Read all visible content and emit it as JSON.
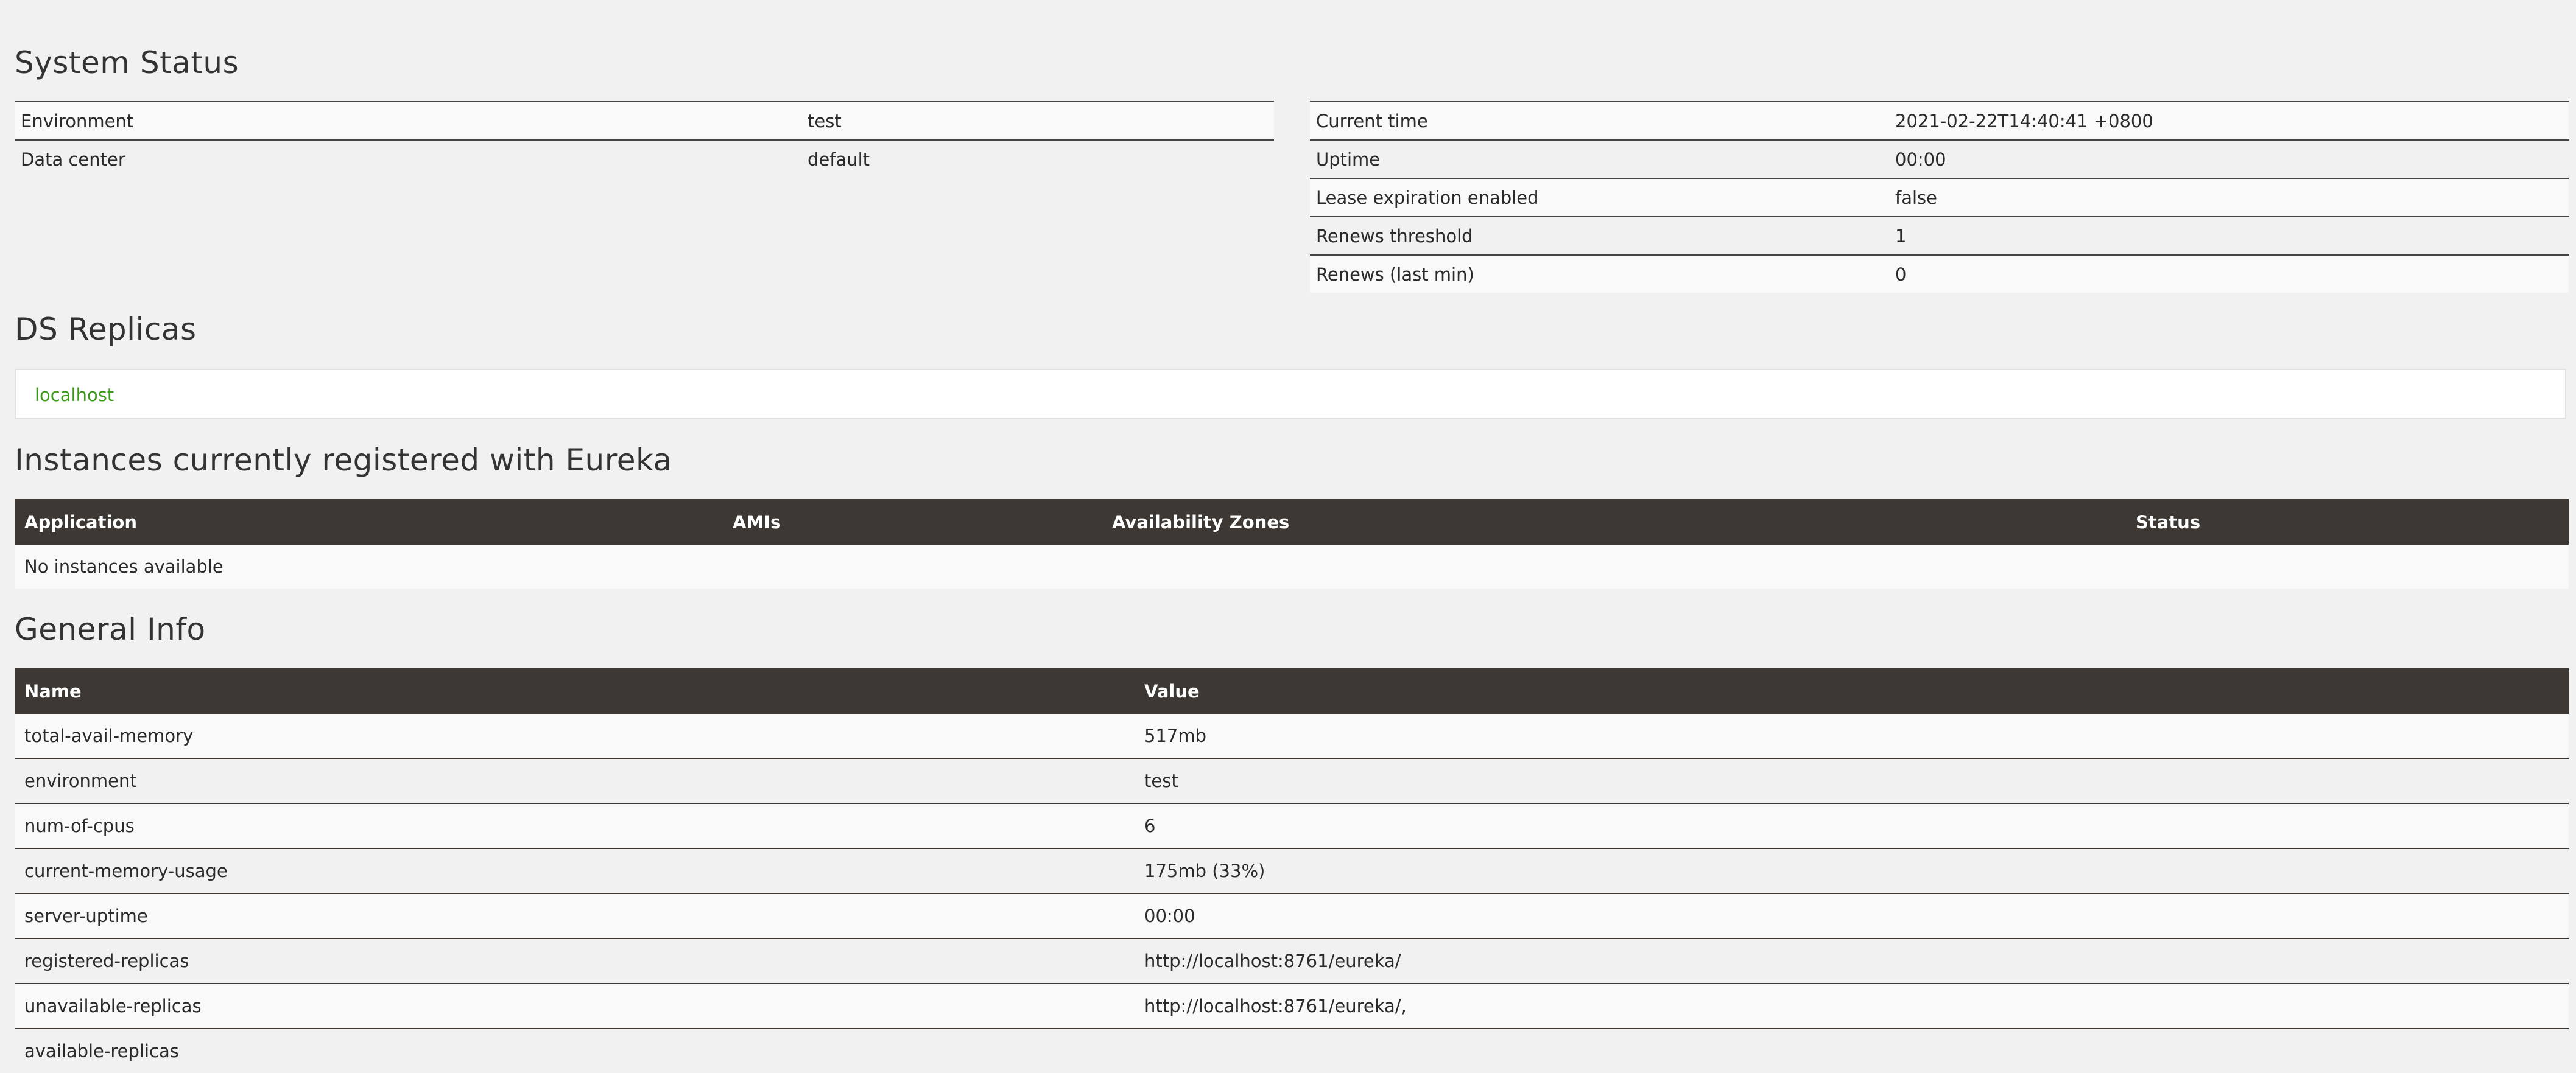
{
  "system_status": {
    "title": "System Status",
    "left_rows": [
      {
        "label": "Environment",
        "value": "test"
      },
      {
        "label": "Data center",
        "value": "default"
      }
    ],
    "right_rows": [
      {
        "label": "Current time",
        "value": "2021-02-22T14:40:41 +0800"
      },
      {
        "label": "Uptime",
        "value": "00:00"
      },
      {
        "label": "Lease expiration enabled",
        "value": "false"
      },
      {
        "label": "Renews threshold",
        "value": "1"
      },
      {
        "label": "Renews (last min)",
        "value": "0"
      }
    ]
  },
  "ds_replicas": {
    "title": "DS Replicas",
    "link": "localhost"
  },
  "instances": {
    "title": "Instances currently registered with Eureka",
    "columns": [
      "Application",
      "AMIs",
      "Availability Zones",
      "Status"
    ],
    "empty_message": "No instances available"
  },
  "general_info": {
    "title": "General Info",
    "columns": [
      "Name",
      "Value"
    ],
    "rows": [
      {
        "name": "total-avail-memory",
        "value": "517mb"
      },
      {
        "name": "environment",
        "value": "test"
      },
      {
        "name": "num-of-cpus",
        "value": "6"
      },
      {
        "name": "current-memory-usage",
        "value": "175mb (33%)"
      },
      {
        "name": "server-uptime",
        "value": "00:00"
      },
      {
        "name": "registered-replicas",
        "value": "http://localhost:8761/eureka/"
      },
      {
        "name": "unavailable-replicas",
        "value": "http://localhost:8761/eureka/,"
      },
      {
        "name": "available-replicas",
        "value": ""
      }
    ]
  },
  "colors": {
    "background": "#f1f1f1",
    "header_dark": "#3d3833",
    "link_green": "#3c9a1a"
  }
}
